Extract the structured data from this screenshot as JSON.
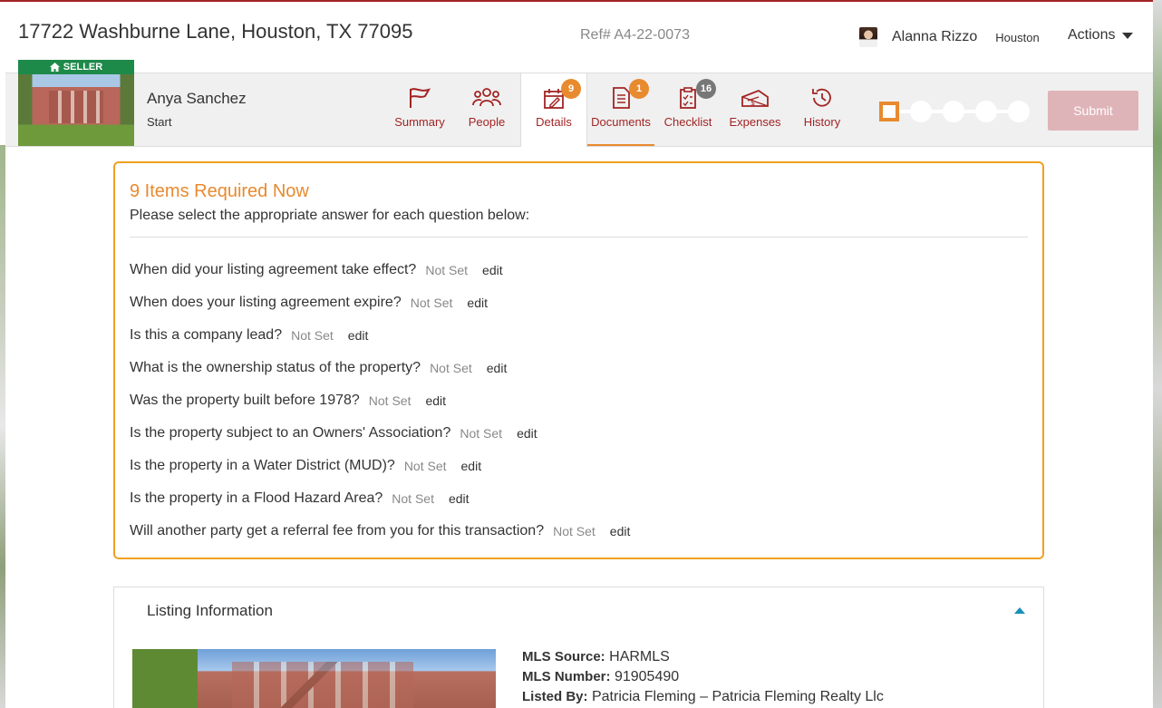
{
  "header": {
    "address": "17722 Washburne Lane, Houston, TX 77095",
    "ref": "Ref# A4-22-0073",
    "user_name": "Alanna Rizzo",
    "office": "Houston",
    "actions_label": "Actions"
  },
  "transaction": {
    "side_badge": "SELLER",
    "client_name": "Anya Sanchez",
    "stage": "Start"
  },
  "nav": {
    "summary": {
      "label": "Summary",
      "icon": "flag-icon"
    },
    "people": {
      "label": "People",
      "icon": "people-icon"
    },
    "details": {
      "label": "Details",
      "icon": "calendar-edit-icon",
      "badge": "9"
    },
    "documents": {
      "label": "Documents",
      "icon": "document-icon",
      "badge": "1"
    },
    "checklist": {
      "label": "Checklist",
      "icon": "clipboard-icon",
      "badge": "16"
    },
    "expenses": {
      "label": "Expenses",
      "icon": "money-icon"
    },
    "history": {
      "label": "History",
      "icon": "history-icon"
    }
  },
  "progress": {
    "current_step": 1,
    "total_steps": 5
  },
  "submit_label": "Submit",
  "required": {
    "title": "9 Items Required Now",
    "subtitle": "Please select the appropriate answer for each question below:",
    "questions": [
      {
        "q": "When did your listing agreement take effect?",
        "status": "Not Set",
        "action": "edit"
      },
      {
        "q": "When does your listing agreement expire?",
        "status": "Not Set",
        "action": "edit"
      },
      {
        "q": "Is this a company lead?",
        "status": "Not Set",
        "action": "edit"
      },
      {
        "q": "What is the ownership status of the property?",
        "status": "Not Set",
        "action": "edit"
      },
      {
        "q": "Was the property built before 1978?",
        "status": "Not Set",
        "action": "edit"
      },
      {
        "q": "Is the property subject to an Owners' Association?",
        "status": "Not Set",
        "action": "edit"
      },
      {
        "q": "Is the property in a Water District (MUD)?",
        "status": "Not Set",
        "action": "edit"
      },
      {
        "q": "Is the property in a Flood Hazard Area?",
        "status": "Not Set",
        "action": "edit"
      },
      {
        "q": "Will another party get a referral fee from you for this transaction?",
        "status": "Not Set",
        "action": "edit"
      }
    ]
  },
  "listing": {
    "title": "Listing Information",
    "mls_source_label": "MLS Source:",
    "mls_source": "HARMLS",
    "mls_number_label": "MLS Number:",
    "mls_number": "91905490",
    "listed_by_label": "Listed By:",
    "listed_by": "Patricia Fleming – Patricia Fleming Realty Llc"
  },
  "colors": {
    "brand": "#a32424",
    "accent": "#e88a2e",
    "seller_badge": "#1e8a4a",
    "submit_disabled": "#dfb4b8"
  }
}
